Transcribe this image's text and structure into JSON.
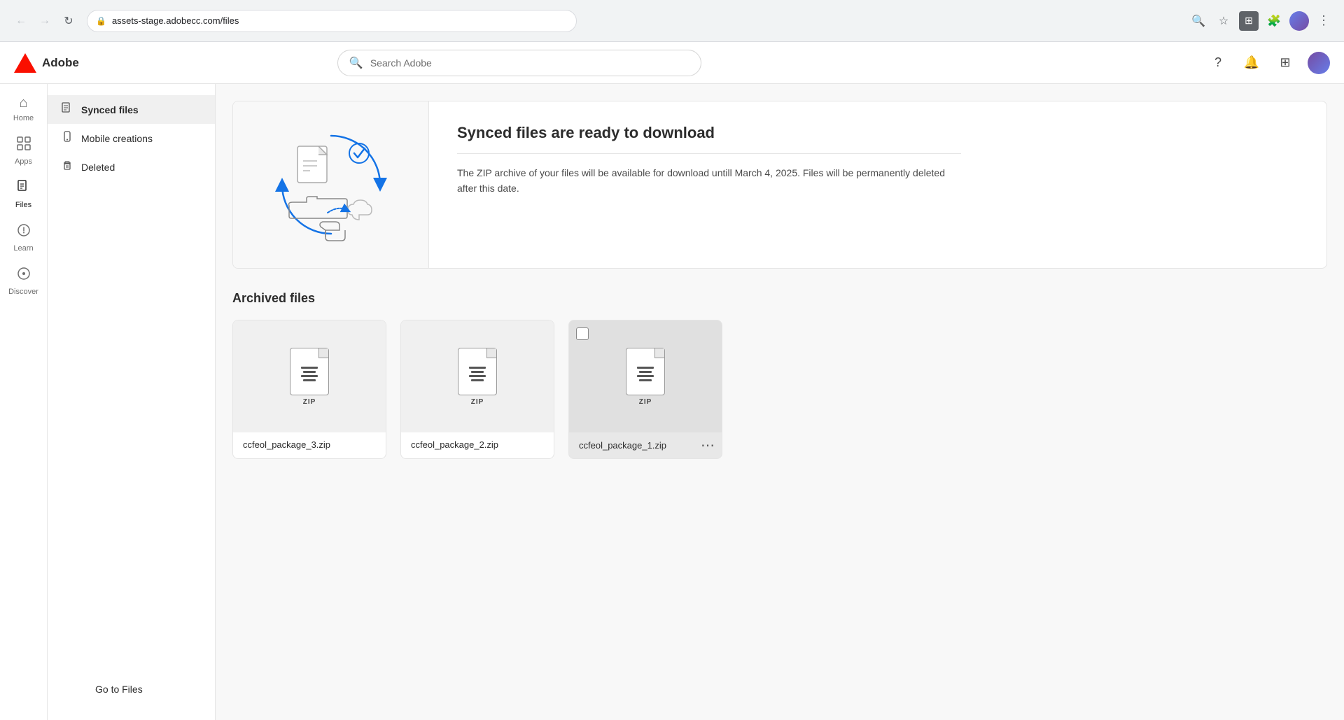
{
  "browser": {
    "url": "assets-stage.adobecc.com/files",
    "back_title": "Back",
    "forward_title": "Forward",
    "reload_title": "Reload"
  },
  "header": {
    "logo_text": "Adobe",
    "search_placeholder": "Search Adobe"
  },
  "sidebar": {
    "items": [
      {
        "id": "home",
        "label": "Home",
        "icon": "⌂",
        "active": false
      },
      {
        "id": "apps",
        "label": "Apps",
        "icon": "⊞",
        "active": false
      },
      {
        "id": "files",
        "label": "Files",
        "icon": "📄",
        "active": true
      },
      {
        "id": "learn",
        "label": "Learn",
        "icon": "💡",
        "active": false
      },
      {
        "id": "discover",
        "label": "Discover",
        "icon": "🔍",
        "active": false
      }
    ]
  },
  "nav": {
    "items": [
      {
        "id": "synced-files",
        "label": "Synced files",
        "icon": "📄",
        "active": true
      },
      {
        "id": "mobile-creations",
        "label": "Mobile creations",
        "icon": "📱",
        "active": false
      },
      {
        "id": "deleted",
        "label": "Deleted",
        "icon": "🗑",
        "active": false
      }
    ],
    "go_to_files_label": "Go to Files"
  },
  "synced_banner": {
    "title": "Synced files are ready to download",
    "description": "The ZIP archive of your files will be available for download untill March 4, 2025. Files will be permanently deleted after this date."
  },
  "archived_section": {
    "title": "Archived files",
    "files": [
      {
        "id": "pkg3",
        "name": "ccfeol_package_3.zip",
        "has_menu": false,
        "has_checkbox": false
      },
      {
        "id": "pkg2",
        "name": "ccfeol_package_2.zip",
        "has_menu": false,
        "has_checkbox": false
      },
      {
        "id": "pkg1",
        "name": "ccfeol_package_1.zip",
        "has_menu": true,
        "has_checkbox": true
      }
    ],
    "zip_label": "ZIP"
  }
}
